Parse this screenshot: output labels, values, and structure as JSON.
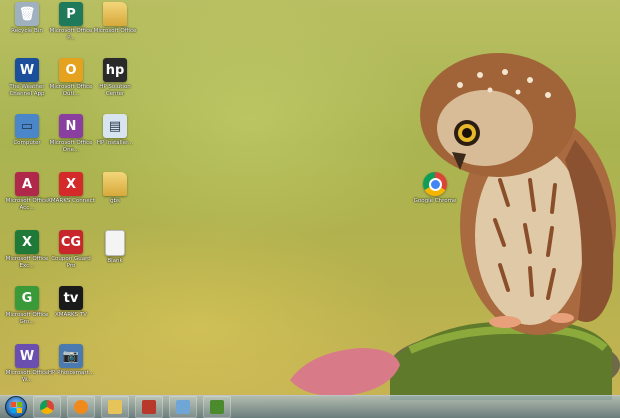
{
  "desktop_icons": [
    {
      "name": "icon-recycle-bin",
      "label": "Recycle Bin",
      "icon": "trash-icon",
      "color": "#9fb0bf",
      "glyph": "🗑"
    },
    {
      "name": "icon-office-publisher",
      "label": "Microsoft Office P...",
      "icon": "publisher-icon",
      "color": "#1e7a5a",
      "glyph": "P"
    },
    {
      "name": "icon-office-folder",
      "label": "Microsoft Office",
      "icon": "folder-icon",
      "color": "#e7c45a",
      "glyph": ""
    },
    {
      "name": "icon-weather-channel",
      "label": "The Weather Channel App",
      "icon": "weather-icon",
      "color": "#1b4f9c",
      "glyph": "W"
    },
    {
      "name": "icon-office-outlook",
      "label": "Microsoft Office Outl...",
      "icon": "outlook-icon",
      "color": "#e5a21f",
      "glyph": "O"
    },
    {
      "name": "icon-hp-solution-center",
      "label": "HP Solution Center",
      "icon": "hp-icon",
      "color": "#2a2a2a",
      "glyph": "hp"
    },
    {
      "name": "icon-computer",
      "label": "Computer",
      "icon": "computer-icon",
      "color": "#4a86c8",
      "glyph": "▭"
    },
    {
      "name": "icon-office-onenote",
      "label": "Microsoft Office One...",
      "icon": "onenote-icon",
      "color": "#8a3fa0",
      "glyph": "N"
    },
    {
      "name": "icon-hp-installer",
      "label": "HP Installer...",
      "icon": "window-icon",
      "color": "#d8e4f0",
      "glyph": "▤"
    },
    {
      "name": "icon-office-access",
      "label": "Microsoft Office Acc...",
      "icon": "access-icon",
      "color": "#b0284a",
      "glyph": "A"
    },
    {
      "name": "icon-xmarks-connect",
      "label": "XMARKS Connect",
      "icon": "x-icon",
      "color": "#d42a2a",
      "glyph": "X"
    },
    {
      "name": "icon-gbs-folder",
      "label": "gbs",
      "icon": "folder-icon",
      "color": "#e7c45a",
      "glyph": ""
    },
    {
      "name": "icon-office-excel",
      "label": "Microsoft Office Exc...",
      "icon": "excel-icon",
      "color": "#1f7a3a",
      "glyph": "X"
    },
    {
      "name": "icon-coupon-guard",
      "label": "Coupon Guard Pro",
      "icon": "cg-icon",
      "color": "#c8262a",
      "glyph": "CG"
    },
    {
      "name": "icon-blank-document",
      "label": "Blank",
      "icon": "document-icon",
      "color": "#f4f4f4",
      "glyph": ""
    },
    {
      "name": "icon-office-groove",
      "label": "Microsoft Office Gro...",
      "icon": "groove-icon",
      "color": "#3a9a3a",
      "glyph": "G"
    },
    {
      "name": "icon-xtv",
      "label": "XMARKS TV",
      "icon": "tv-icon",
      "color": "#1a1a1a",
      "glyph": "tv"
    },
    {
      "name": "icon-office-word",
      "label": "Microsoft Office W...",
      "icon": "word-icon",
      "color": "#6a4fb0",
      "glyph": "W"
    },
    {
      "name": "icon-hp-photosmart",
      "label": "HP Photosmart...",
      "icon": "photosmart-icon",
      "color": "#4a7ab0",
      "glyph": "📷"
    },
    {
      "name": "icon-google-chrome",
      "label": "Google Chrome",
      "icon": "chrome-icon",
      "color": "#ffffff",
      "glyph": ""
    }
  ],
  "taskbar": {
    "start_label": "Start",
    "pinned": [
      {
        "name": "taskbar-chrome",
        "icon": "chrome-icon",
        "color": "#e8e8e8"
      },
      {
        "name": "taskbar-media-player",
        "icon": "media-player-icon",
        "color": "#f08a1c"
      },
      {
        "name": "taskbar-explorer",
        "icon": "folder-icon",
        "color": "#e7c45a"
      },
      {
        "name": "taskbar-photo-app",
        "icon": "photo-icon",
        "color": "#b8382c"
      },
      {
        "name": "taskbar-paper-app",
        "icon": "paper-icon",
        "color": "#6fa6d6"
      },
      {
        "name": "taskbar-minecraft",
        "icon": "minecraft-icon",
        "color": "#4c8a2e"
      }
    ]
  },
  "colors": {
    "wallpaper_top": "#b8bf62",
    "wallpaper_bottom": "#c9b455",
    "taskbar": "#6f8a9a"
  }
}
